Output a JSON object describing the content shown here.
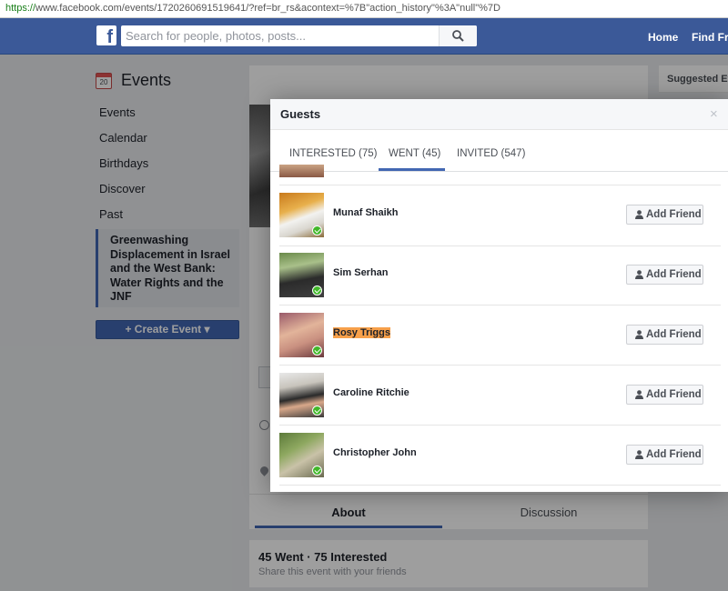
{
  "browser": {
    "url_protocol": "https://",
    "url_rest": "www.facebook.com/events/1720260691519641/?ref=br_rs&acontext=%7B\"action_history\"%3A\"null\"%7D"
  },
  "header": {
    "logo_letter": "f",
    "search_placeholder": "Search for people, photos, posts...",
    "nav": {
      "home": "Home",
      "find_friends": "Find Frie"
    },
    "colors": {
      "brand": "#3b5998"
    }
  },
  "sidebar": {
    "title": "Events",
    "calendar_day": "20",
    "items": [
      "Events",
      "Calendar",
      "Birthdays",
      "Discover",
      "Past"
    ],
    "active_event": "Greenwashing Displacement in Israel and the West Bank: Water Rights and the JNF",
    "create_event": "+ Create Event ▾"
  },
  "right_col": {
    "title": "Suggested Ev"
  },
  "event": {
    "tabs": {
      "about": "About",
      "discussion": "Discussion"
    },
    "stats_title": "45 Went · 75 Interested",
    "stats_sub": "Share this event with your friends"
  },
  "modal": {
    "title": "Guests",
    "close": "×",
    "tabs": {
      "interested": "INTERESTED (75)",
      "went": "WENT (45)",
      "invited": "INVITED (547)"
    },
    "active_tab": "went",
    "add_friend_label": "Add Friend",
    "guests": [
      {
        "name": "Munaf Shaikh",
        "highlighted": false
      },
      {
        "name": "Sim Serhan",
        "highlighted": false
      },
      {
        "name": "Rosy Triggs",
        "highlighted": true
      },
      {
        "name": "Caroline Ritchie",
        "highlighted": false
      },
      {
        "name": "Christopher John",
        "highlighted": false
      }
    ]
  }
}
